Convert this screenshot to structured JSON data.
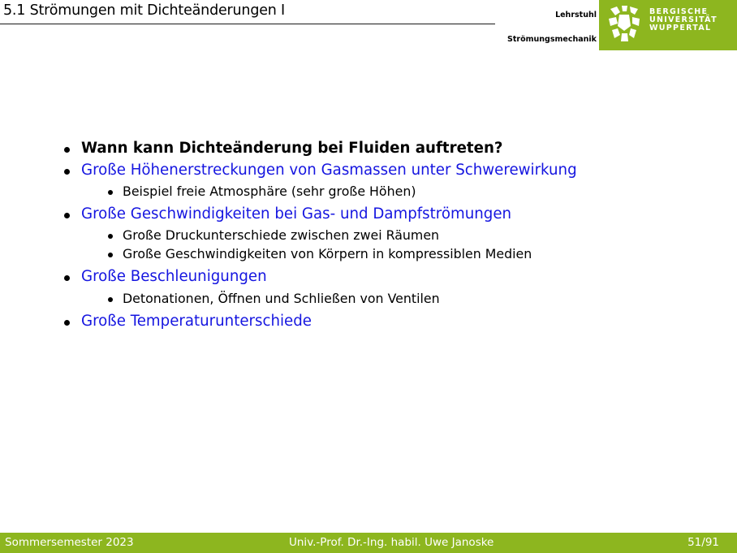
{
  "header": {
    "title": "5.1 Strömungen mit Dichteänderungen I",
    "chair_line1": "Lehrstuhl",
    "chair_line2": "Strömungsmechanik",
    "university": [
      "BERGISCHE",
      "UNIVERSITÄT",
      "WUPPERTAL"
    ],
    "brand_color": "#8db61f"
  },
  "content": [
    {
      "text": "Wann kann Dichteänderung bei Fluiden auftreten?",
      "style": "bold"
    },
    {
      "text": "Große Höhenerstreckungen von Gasmassen unter Schwerewirkung",
      "style": "blue",
      "sub": [
        "Beispiel freie Atmosphäre (sehr große Höhen)"
      ]
    },
    {
      "text": "Große Geschwindigkeiten bei Gas- und Dampfströmungen",
      "style": "blue",
      "sub": [
        "Große Druckunterschiede zwischen zwei Räumen",
        "Große Geschwindigkeiten von Körpern in kompressiblen Medien"
      ]
    },
    {
      "text": "Große Beschleunigungen",
      "style": "blue",
      "sub": [
        "Detonationen, Öffnen und Schließen von Ventilen"
      ]
    },
    {
      "text": "Große Temperaturunterschiede",
      "style": "blue"
    }
  ],
  "footer": {
    "semester": "Sommersemester 2023",
    "author": "Univ.-Prof. Dr.-Ing. habil. Uwe Janoske",
    "page": "51/91"
  }
}
